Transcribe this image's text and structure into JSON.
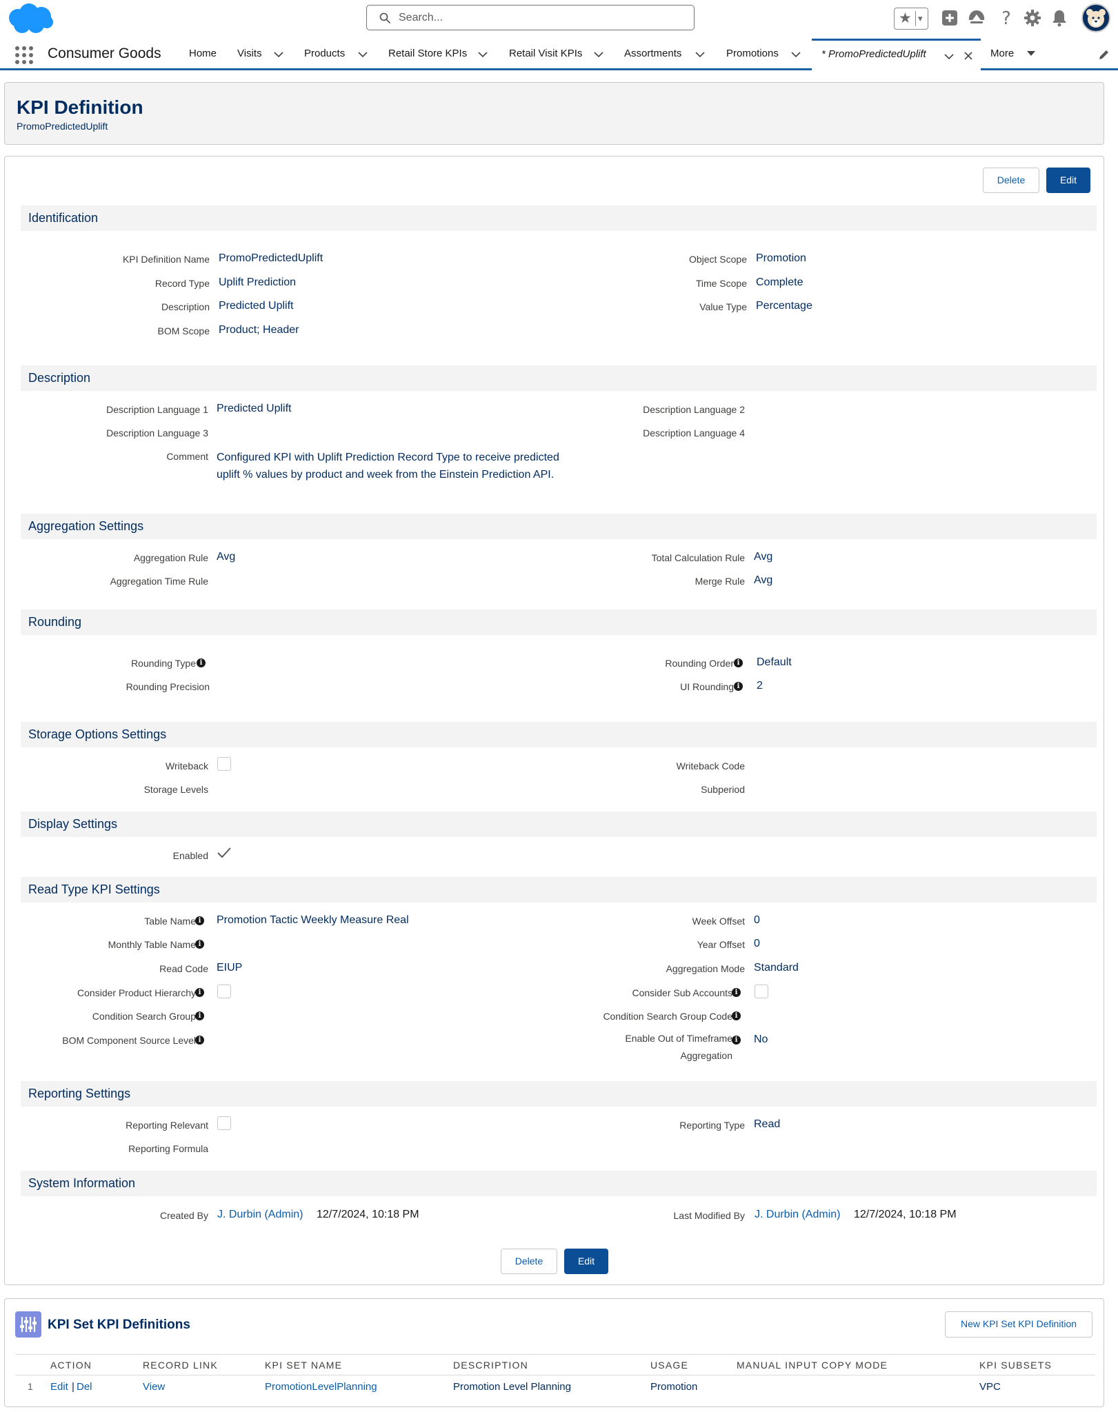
{
  "header": {
    "search_placeholder": "Search...",
    "app_name": "Consumer Goods",
    "nav": [
      {
        "label": "Home"
      },
      {
        "label": "Visits"
      },
      {
        "label": "Products"
      },
      {
        "label": "Retail Store KPIs"
      },
      {
        "label": "Retail Visit KPIs"
      },
      {
        "label": "Assortments"
      },
      {
        "label": "Promotions"
      }
    ],
    "active_tab": "* PromoPredictedUplift",
    "more": "More"
  },
  "page": {
    "object_label": "KPI Definition",
    "record_name": "PromoPredictedUplift"
  },
  "actions": {
    "delete": "Delete",
    "edit": "Edit"
  },
  "sections": {
    "identification": {
      "title": "Identification",
      "kpi_name_label": "KPI Definition Name",
      "kpi_name_value": "PromoPredictedUplift",
      "record_type_label": "Record Type",
      "record_type_value": "Uplift Prediction",
      "description_label": "Description",
      "description_value": "Predicted Uplift",
      "bom_scope_label": "BOM Scope",
      "bom_scope_value": "Product; Header",
      "object_scope_label": "Object Scope",
      "object_scope_value": "Promotion",
      "time_scope_label": "Time Scope",
      "time_scope_value": "Complete",
      "value_type_label": "Value Type",
      "value_type_value": "Percentage"
    },
    "description": {
      "title": "Description",
      "lang1_label": "Description Language 1",
      "lang1_value": "Predicted Uplift",
      "lang2_label": "Description Language 2",
      "lang3_label": "Description Language 3",
      "lang4_label": "Description Language 4",
      "comment_label": "Comment",
      "comment_value": "Configured KPI with Uplift Prediction Record Type to receive predicted uplift % values by product and week from the Einstein Prediction API."
    },
    "aggregation": {
      "title": "Aggregation Settings",
      "rule_label": "Aggregation Rule",
      "rule_value": "Avg",
      "time_rule_label": "Aggregation Time Rule",
      "total_calc_label": "Total Calculation Rule",
      "total_calc_value": "Avg",
      "merge_label": "Merge Rule",
      "merge_value": "Avg"
    },
    "rounding": {
      "title": "Rounding",
      "type_label": "Rounding Type",
      "precision_label": "Rounding Precision",
      "order_label": "Rounding Order",
      "order_value": "Default",
      "ui_label": "UI Rounding",
      "ui_value": "2"
    },
    "storage": {
      "title": "Storage Options Settings",
      "writeback_label": "Writeback",
      "levels_label": "Storage Levels",
      "writeback_code_label": "Writeback Code",
      "subperiod_label": "Subperiod"
    },
    "display": {
      "title": "Display Settings",
      "enabled_label": "Enabled"
    },
    "read_type": {
      "title": "Read Type KPI Settings",
      "table_label": "Table Name",
      "table_value": "Promotion Tactic Weekly Measure Real",
      "monthly_label": "Monthly Table Name",
      "read_code_label": "Read Code",
      "read_code_value": "EIUP",
      "hierarchy_label": "Consider Product Hierarchy",
      "csg_label": "Condition Search Group",
      "bom_src_label": "BOM Component Source Level",
      "week_offset_label": "Week Offset",
      "week_offset_value": "0",
      "year_offset_label": "Year Offset",
      "year_offset_value": "0",
      "agg_mode_label": "Aggregation Mode",
      "agg_mode_value": "Standard",
      "sub_accounts_label": "Consider Sub Accounts",
      "csg_code_label": "Condition Search Group Code",
      "oot_label": "Enable Out of Timeframe Aggregation",
      "oot_value": "No"
    },
    "reporting": {
      "title": "Reporting Settings",
      "relevant_label": "Reporting Relevant",
      "formula_label": "Reporting Formula",
      "type_label": "Reporting Type",
      "type_value": "Read"
    },
    "system": {
      "title": "System Information",
      "created_label": "Created By",
      "created_user": "J. Durbin (Admin)",
      "created_date": "12/7/2024, 10:18 PM",
      "modified_label": "Last Modified By",
      "modified_user": "J. Durbin (Admin)",
      "modified_date": "12/7/2024, 10:18 PM"
    }
  },
  "related": {
    "title": "KPI Set KPI Definitions",
    "new_button": "New KPI Set KPI Definition",
    "columns": [
      "ACTION",
      "RECORD LINK",
      "KPI SET NAME",
      "DESCRIPTION",
      "USAGE",
      "MANUAL INPUT COPY MODE",
      "KPI SUBSETS"
    ],
    "rows": [
      {
        "num": "1",
        "edit": "Edit",
        "sep": "|",
        "del": "Del",
        "record_link": "View",
        "kpi_set_name": "PromotionLevelPlanning",
        "description": "Promotion Level Planning",
        "usage": "Promotion",
        "manual_input_copy_mode": "",
        "kpi_subsets": "VPC"
      }
    ]
  },
  "colors": {
    "brand": "#0b4e96",
    "nav_accent": "#1b5fa6",
    "text_value": "#032d60",
    "link": "#0b5cab",
    "cloud": "#1b96ff"
  }
}
